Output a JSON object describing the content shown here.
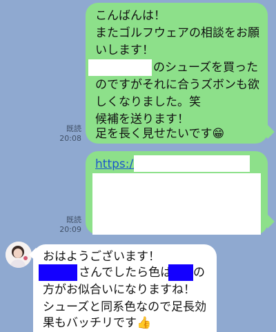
{
  "messages": [
    {
      "side": "out",
      "read": "既読",
      "time": "20:08",
      "lines": [
        "こんばんは！",
        "またゴルフウェアの相談をお願",
        "いします！",
        "のシューズを買った",
        "のですがそれに合うズボンも欲",
        "しくなりました。笑",
        "候補を送ります！",
        "足を長く見せたいです😁"
      ]
    },
    {
      "side": "out",
      "read": "既読",
      "time": "20:09",
      "link_text": "https://"
    },
    {
      "side": "in",
      "lines": [
        "おはようございます！",
        "さんでしたら色は",
        "の",
        "方がお似合いになりますね！",
        "シューズと同系色なので足長効",
        "果もバッチリです👍"
      ]
    }
  ],
  "colors": {
    "background": "#8fa9d0",
    "outgoing_bubble": "#8de08a",
    "incoming_bubble": "#ffffff",
    "redaction": "#1400ff"
  }
}
